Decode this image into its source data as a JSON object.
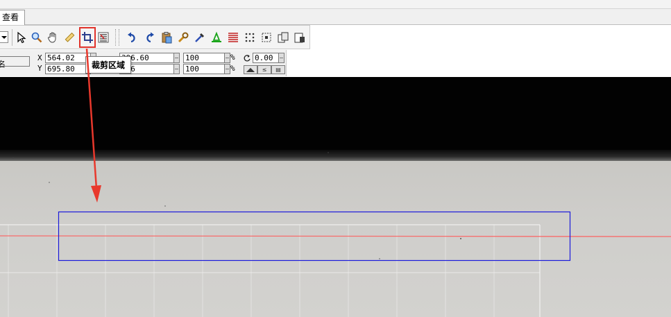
{
  "tab": {
    "label": "查看"
  },
  "toolbar": {
    "tools": [
      {
        "name": "select-pointer-icon"
      },
      {
        "name": "zoom-magnifier-icon"
      },
      {
        "name": "hand-pan-icon"
      },
      {
        "name": "ruler-measure-icon"
      },
      {
        "name": "crop-icon"
      },
      {
        "name": "list-properties-icon"
      },
      {
        "name": "undo-icon"
      },
      {
        "name": "redo-icon"
      },
      {
        "name": "clipboard-paste-icon"
      },
      {
        "name": "wrench-settings-icon"
      },
      {
        "name": "eyedropper-icon"
      },
      {
        "name": "laser-icon"
      },
      {
        "name": "fill-lines-icon"
      },
      {
        "name": "dots-grid-icon"
      },
      {
        "name": "select-region-icon"
      },
      {
        "name": "copy-page-icon"
      },
      {
        "name": "export-icon"
      }
    ],
    "tooltip": "裁剪区域"
  },
  "properties": {
    "name_label_partial": "名",
    "x_label": "X",
    "y_label": "Y",
    "x_value": "564.02",
    "y_value": "695.80",
    "width_value_partial": "396.60",
    "height_value_partial": ".66",
    "scale_x": "100",
    "scale_y": "100",
    "percent_symbol": "%",
    "rotation": "0.00"
  },
  "colors": {
    "highlight_red": "#e0322a",
    "selection_blue": "#1a1adb",
    "laser_line": "#ff5a5a"
  }
}
